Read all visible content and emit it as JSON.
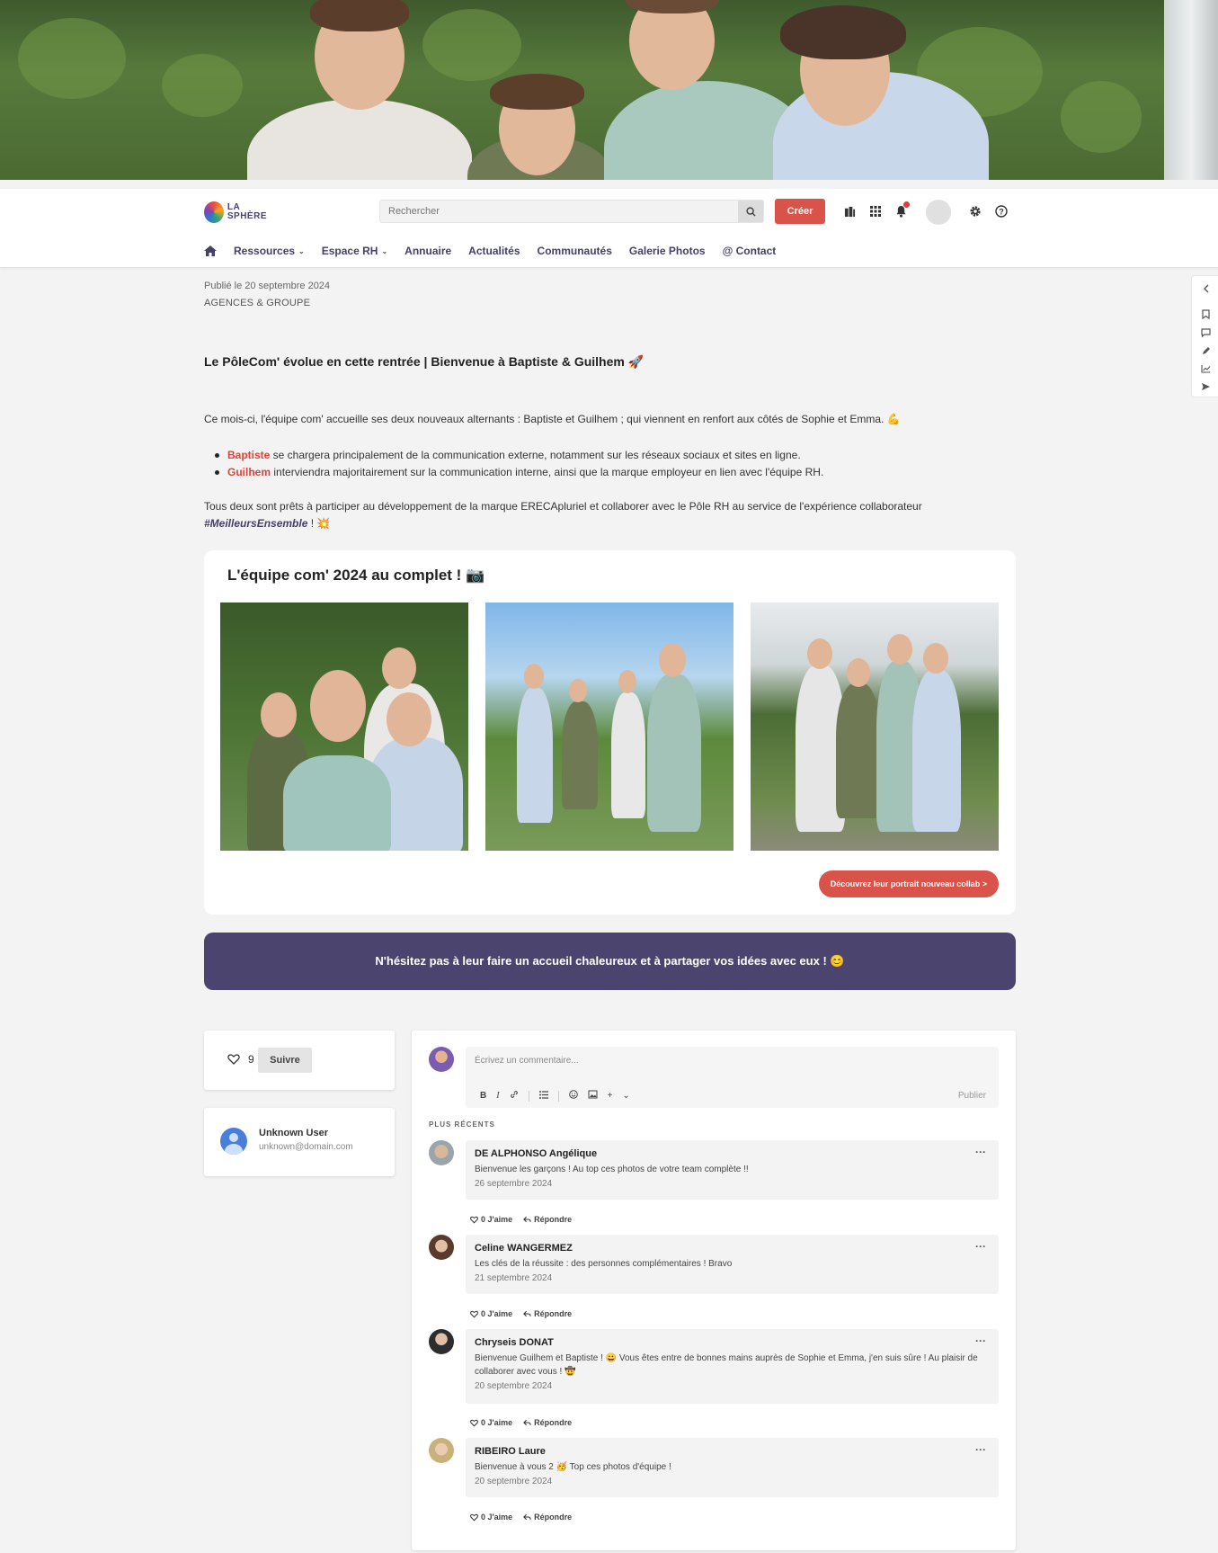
{
  "header": {
    "logo_line1": "LA",
    "logo_line2": "SPHÈRE",
    "search_placeholder": "Rechercher",
    "create_label": "Créer"
  },
  "nav": {
    "items": [
      {
        "label": "Ressources",
        "has_dropdown": true
      },
      {
        "label": "Espace RH",
        "has_dropdown": true
      },
      {
        "label": "Annuaire",
        "has_dropdown": false
      },
      {
        "label": "Actualités",
        "has_dropdown": false
      },
      {
        "label": "Communautés",
        "has_dropdown": false
      },
      {
        "label": "Galerie Photos",
        "has_dropdown": false
      },
      {
        "label": "@ Contact",
        "has_dropdown": false
      }
    ]
  },
  "article": {
    "published": "Publié le 20 septembre 2024",
    "category": "AGENCES & GROUPE",
    "title": "Le PôleCom' évolue en cette rentrée | Bienvenue à Baptiste & Guilhem 🚀",
    "intro": "Ce mois-ci, l'équipe com' accueille ses deux nouveaux alternants : Baptiste et Guilhem ; qui viennent en renfort aux côtés de Sophie et Emma. 💪",
    "bullets": [
      {
        "name": "Baptiste",
        "text": " se chargera principalement de la communication externe, notamment sur les réseaux sociaux et sites en ligne."
      },
      {
        "name": "Guilhem",
        "text": " interviendra majoritairement sur la communication interne, ainsi que la marque employeur en lien avec l'équipe RH."
      }
    ],
    "closing": "Tous deux sont prêts à participer au développement de la marque ERECApluriel et collaborer avec le Pôle RH au service de l'expérience collaborateur",
    "hashtag": "#MeilleursEnsemble",
    "closing_end": " ! 💥"
  },
  "gallery": {
    "title": "L'équipe com' 2024 au complet ! 📷",
    "button_label": "Découvrez leur portrait nouveau collab >"
  },
  "banner": {
    "text": "N'hésitez pas à leur faire un accueil chaleureux et à partager vos idées avec eux ! 😊"
  },
  "sidebar": {
    "like_count": "9",
    "follow_label": "Suivre",
    "user_name": "Unknown User",
    "user_email": "unknown@domain.com"
  },
  "comments": {
    "placeholder": "Écrivez un commentaire...",
    "publish_label": "Publier",
    "section_label": "PLUS RÉCENTS",
    "like_label": "0 J'aime",
    "reply_label": "Répondre",
    "items": [
      {
        "author": "DE ALPHONSO Angélique",
        "text": "Bienvenue les garçons ! Au top ces photos de votre team complète !!",
        "date": "26 septembre 2024"
      },
      {
        "author": "Celine WANGERMEZ",
        "text": "Les clés de la réussite : des personnes complémentaires ! Bravo",
        "date": "21 septembre 2024"
      },
      {
        "author": "Chryseis DONAT",
        "text": "Bienvenue Guilhem et Baptiste ! 😀 Vous êtes entre de bonnes mains auprès de Sophie et Emma, j'en suis sûre ! Au plaisir de collaborer avec vous ! 🤠",
        "date": "20 septembre 2024"
      },
      {
        "author": "RIBEIRO Laure",
        "text": "Bienvenue à vous 2 🥳 Top ces photos d'équipe !",
        "date": "20 septembre 2024"
      }
    ]
  },
  "colors": {
    "accent": "#d9534a",
    "brand": "#4a446f"
  }
}
